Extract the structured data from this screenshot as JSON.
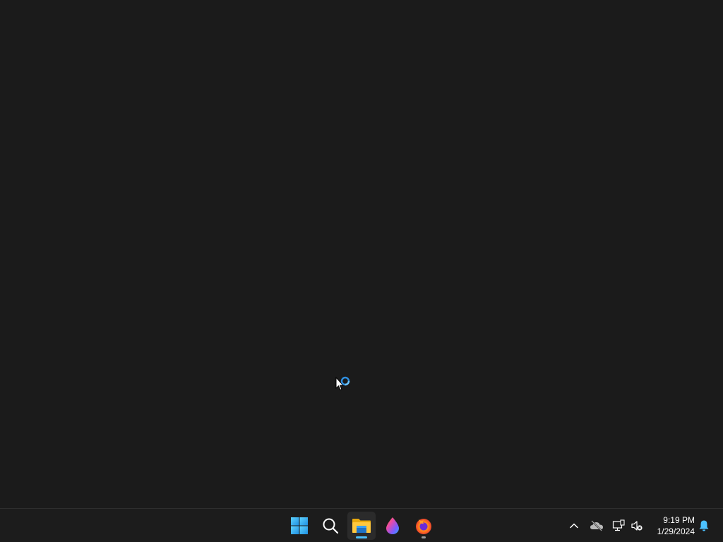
{
  "desktop": {
    "background_color": "#1b1b1b",
    "cursor": "arrow-busy-cursor"
  },
  "taskbar": {
    "apps": [
      {
        "name": "start",
        "icon": "windows-logo-icon",
        "active": false
      },
      {
        "name": "search",
        "icon": "search-icon",
        "active": false
      },
      {
        "name": "file-explorer",
        "icon": "folder-icon",
        "active": true,
        "running": true
      },
      {
        "name": "drop-app",
        "icon": "color-drop-icon",
        "active": false
      },
      {
        "name": "firefox",
        "icon": "firefox-icon",
        "active": false,
        "running": true
      }
    ],
    "tray": {
      "icons": [
        "chevron-up-icon",
        "cloud-offline-icon",
        "network-icon",
        "volume-muted-icon"
      ],
      "time": "9:19 PM",
      "date": "1/29/2024",
      "notification_icon": "bell-icon"
    },
    "accent_color": "#4cc2ff"
  }
}
